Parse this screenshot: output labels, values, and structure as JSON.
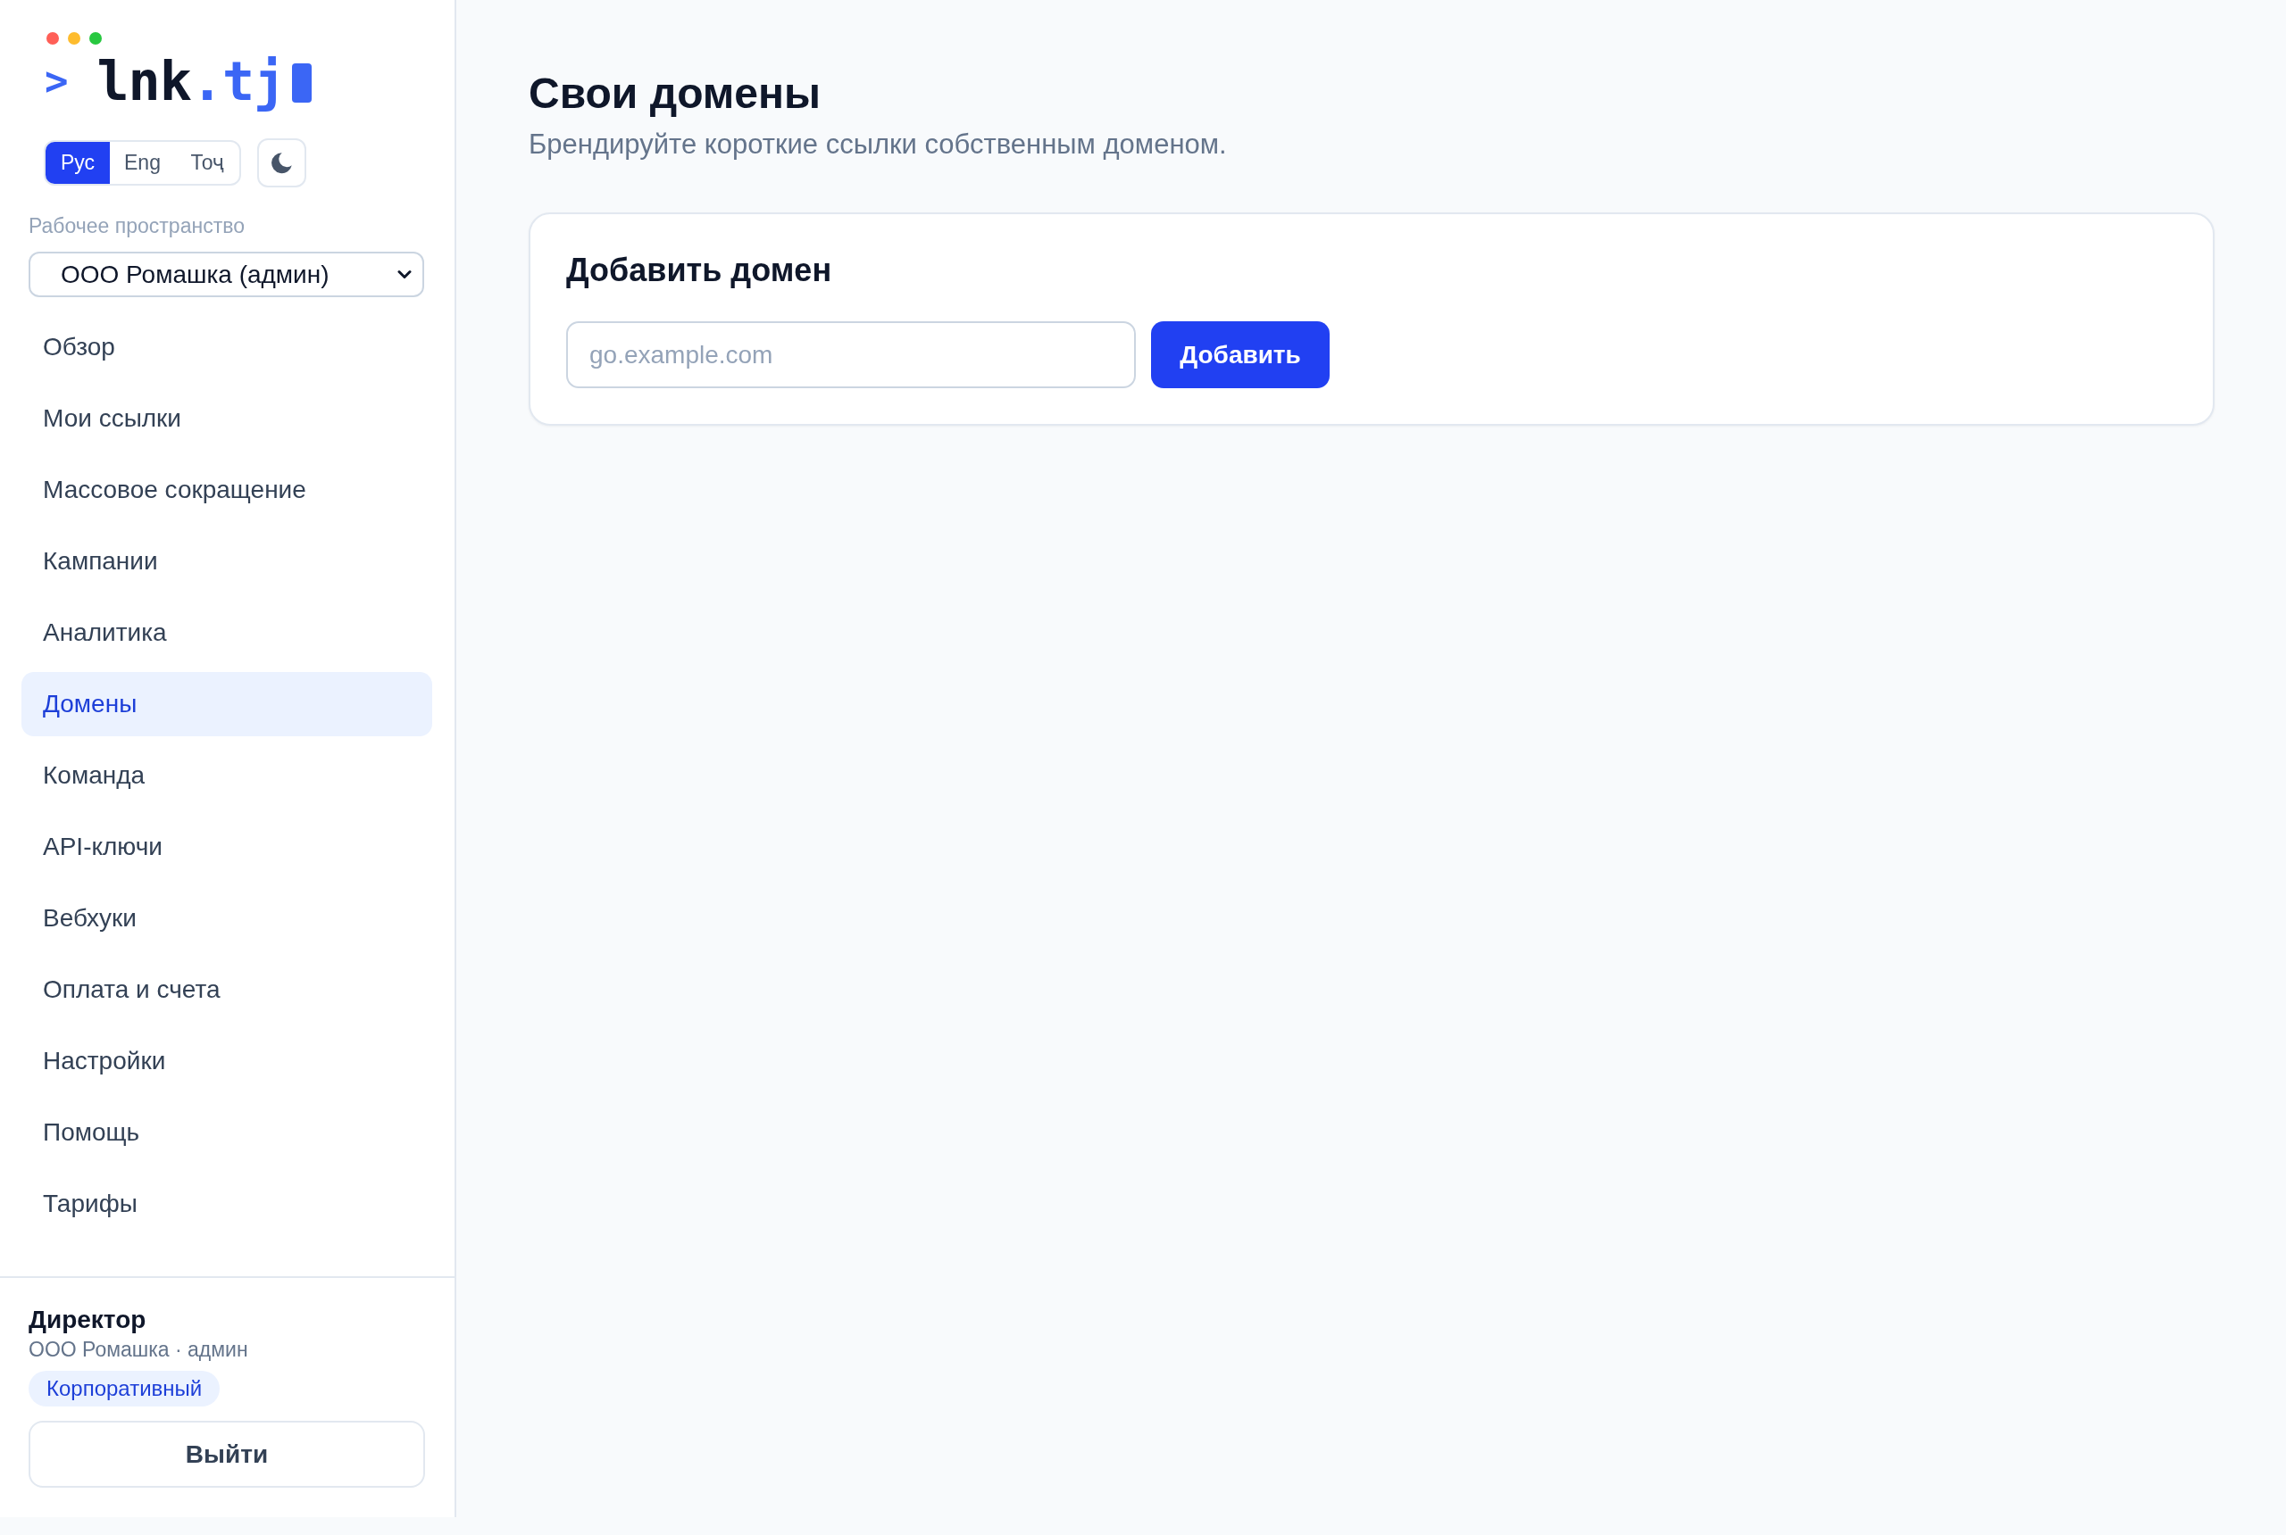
{
  "logo": {
    "prompt": ">",
    "name": "lnk",
    "tld": ".tj"
  },
  "language_switch": [
    {
      "label": "Рус",
      "selected": true
    },
    {
      "label": "Eng",
      "selected": false
    },
    {
      "label": "Тоҷ",
      "selected": false
    }
  ],
  "workspace": {
    "label": "Рабочее пространство",
    "value": "ООО Ромашка (админ)"
  },
  "nav": [
    {
      "label": "Обзор",
      "selected": false
    },
    {
      "label": "Мои ссылки",
      "selected": false
    },
    {
      "label": "Массовое сокращение",
      "selected": false
    },
    {
      "label": "Кампании",
      "selected": false
    },
    {
      "label": "Аналитика",
      "selected": false
    },
    {
      "label": "Домены",
      "selected": true
    },
    {
      "label": "Команда",
      "selected": false
    },
    {
      "label": "API-ключи",
      "selected": false
    },
    {
      "label": "Вебхуки",
      "selected": false
    },
    {
      "label": "Оплата и счета",
      "selected": false
    },
    {
      "label": "Настройки",
      "selected": false
    },
    {
      "label": "Помощь",
      "selected": false
    },
    {
      "label": "Тарифы",
      "selected": false
    }
  ],
  "user": {
    "name": "Директор",
    "org": "ООО Ромашка · админ",
    "plan": "Корпоративный",
    "logout": "Выйти"
  },
  "page": {
    "title": "Свои домены",
    "subtitle": "Брендируйте короткие ссылки собственным доменом."
  },
  "add_domain": {
    "title": "Добавить домен",
    "placeholder": "go.example.com",
    "button": "Добавить"
  }
}
